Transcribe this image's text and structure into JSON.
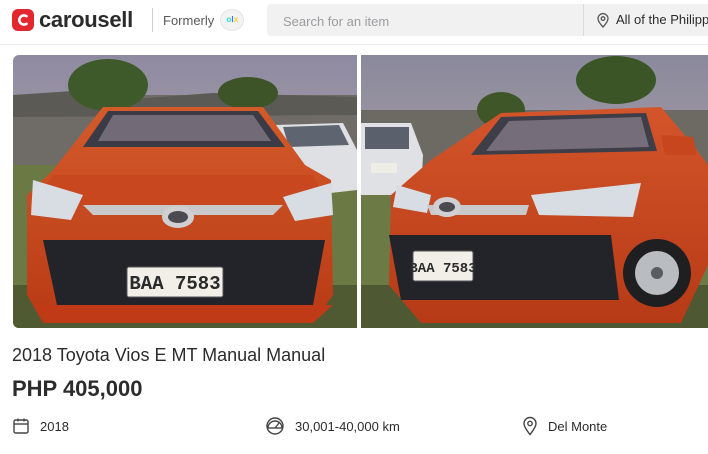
{
  "header": {
    "logo_text": "carousell",
    "formerly_text": "Formerly",
    "olx_badge": {
      "o": "o",
      "l": "l",
      "x": "x"
    },
    "search": {
      "placeholder": "Search for an item",
      "value": ""
    },
    "location": "All of the Philippines"
  },
  "photos": [
    {
      "alt": "Front view of orange 2018 Toyota Vios",
      "plate": "BAA 7583"
    },
    {
      "alt": "Front three-quarter view of orange 2018 Toyota Vios",
      "plate": "BAA 7583"
    }
  ],
  "listing": {
    "title": "2018 Toyota Vios E MT Manual Manual",
    "price": "PHP 405,000",
    "year": "2018",
    "mileage": "30,001-40,000 km",
    "location": "Del Monte"
  },
  "colors": {
    "brand_red": "#e2272e",
    "car_orange": "#d9461d",
    "text": "#2c2c2d"
  },
  "icons": [
    "carousell-logo-icon",
    "olx-badge-icon",
    "location-pin-icon",
    "calendar-icon",
    "speedometer-icon",
    "map-pin-icon"
  ]
}
